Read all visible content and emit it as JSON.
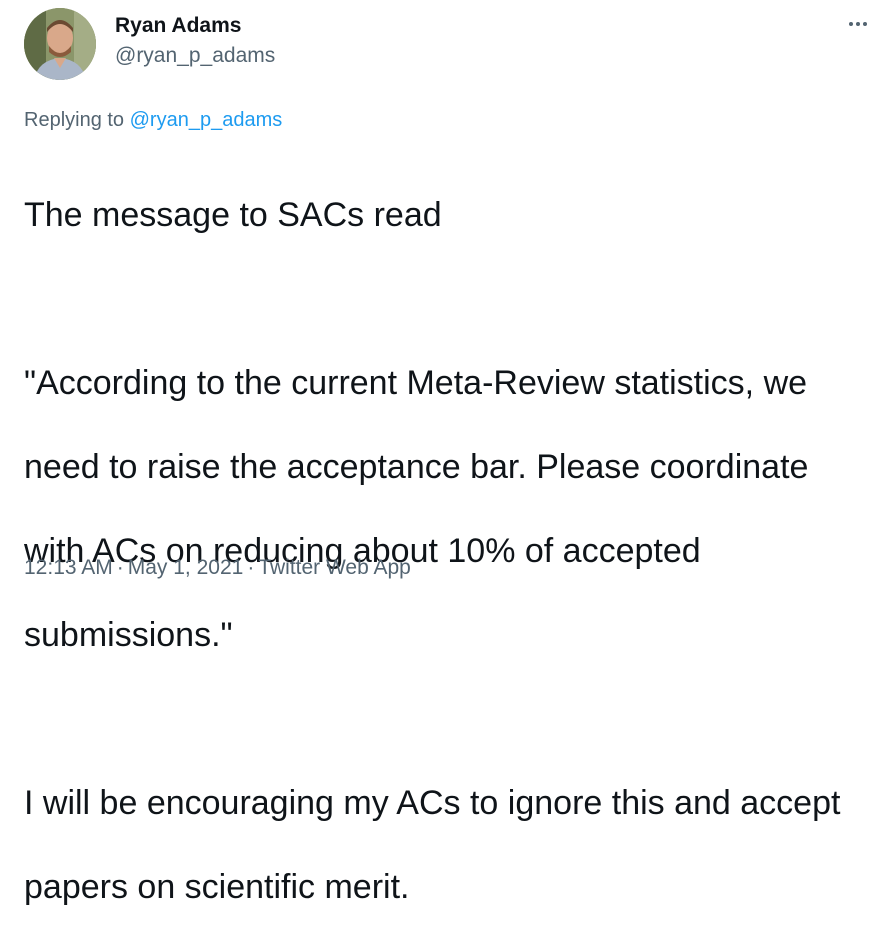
{
  "author": {
    "display_name": "Ryan Adams",
    "handle": "@ryan_p_adams"
  },
  "reply": {
    "prefix": "Replying to",
    "mention": "@ryan_p_adams"
  },
  "tweet": {
    "paragraph_1": "The message to SACs read",
    "paragraph_2_lines": [
      "\"According to the current Meta-Review statistics, we",
      "need to raise the acceptance bar. Please coordinate",
      "with ACs on reducing about 10% of accepted",
      "submissions.\""
    ],
    "paragraph_3_lines": [
      "I will be encouraging my ACs to ignore this and accept",
      "papers on scientific merit."
    ]
  },
  "meta": {
    "time": "12:13 AM",
    "separator": "·",
    "date": "May 1, 2021",
    "source": "Twitter Web App"
  },
  "icons": {
    "more": "more-options-icon",
    "avatar": "profile-photo"
  },
  "colors": {
    "text_primary": "#0f1419",
    "text_secondary": "#536471",
    "link": "#1d9bf0"
  }
}
